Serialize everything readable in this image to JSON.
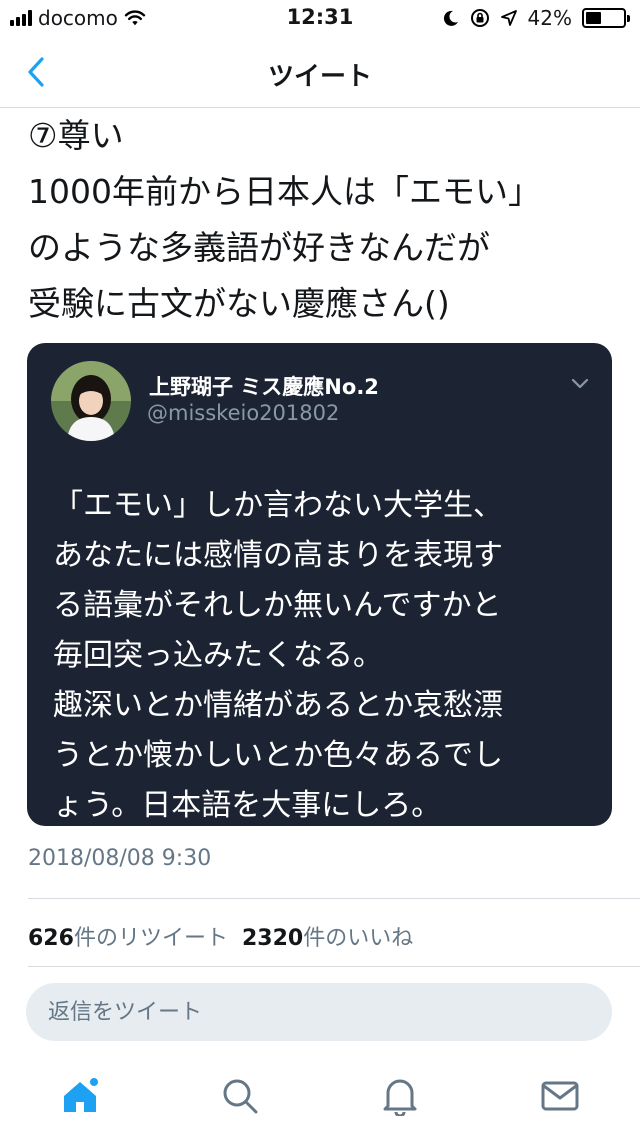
{
  "status_bar": {
    "carrier": "docomo",
    "time": "12:31",
    "battery": "42%",
    "battery_level": 0.42
  },
  "nav": {
    "title": "ツイート",
    "back_icon": "chevron-left-icon"
  },
  "tweet": {
    "text": "⑦尊い\n1000年前から日本人は「エモい」\nのような多義語が好きなんだが\n受験に古文がない慶應さん()"
  },
  "quoted_tweet": {
    "name": "上野瑚子 ミス慶應No.2",
    "handle": "@misskeio201802",
    "body": "「エモい」しか言わない大学生、\nあなたには感情の高まりを表現す\nる語彙がそれしか無いんですかと\n毎回突っ込みたくなる。\n趣深いとか情緒があるとか哀愁漂\nうとか懐かしいとか色々あるでし\nょう。日本語を大事にしろ。"
  },
  "timestamp": "2018/08/08 9:30",
  "stats": {
    "retweets_count": "626",
    "retweets_label": "件のリツイート",
    "likes_count": "2320",
    "likes_label": "件のいいね"
  },
  "reply": {
    "placeholder": "返信をツイート"
  },
  "tabs": {
    "icons": [
      "home-icon",
      "search-icon",
      "bell-icon",
      "mail-icon"
    ]
  },
  "colors": {
    "accent": "#1da1f2",
    "card_bg": "#1c2433",
    "muted": "#657786"
  }
}
